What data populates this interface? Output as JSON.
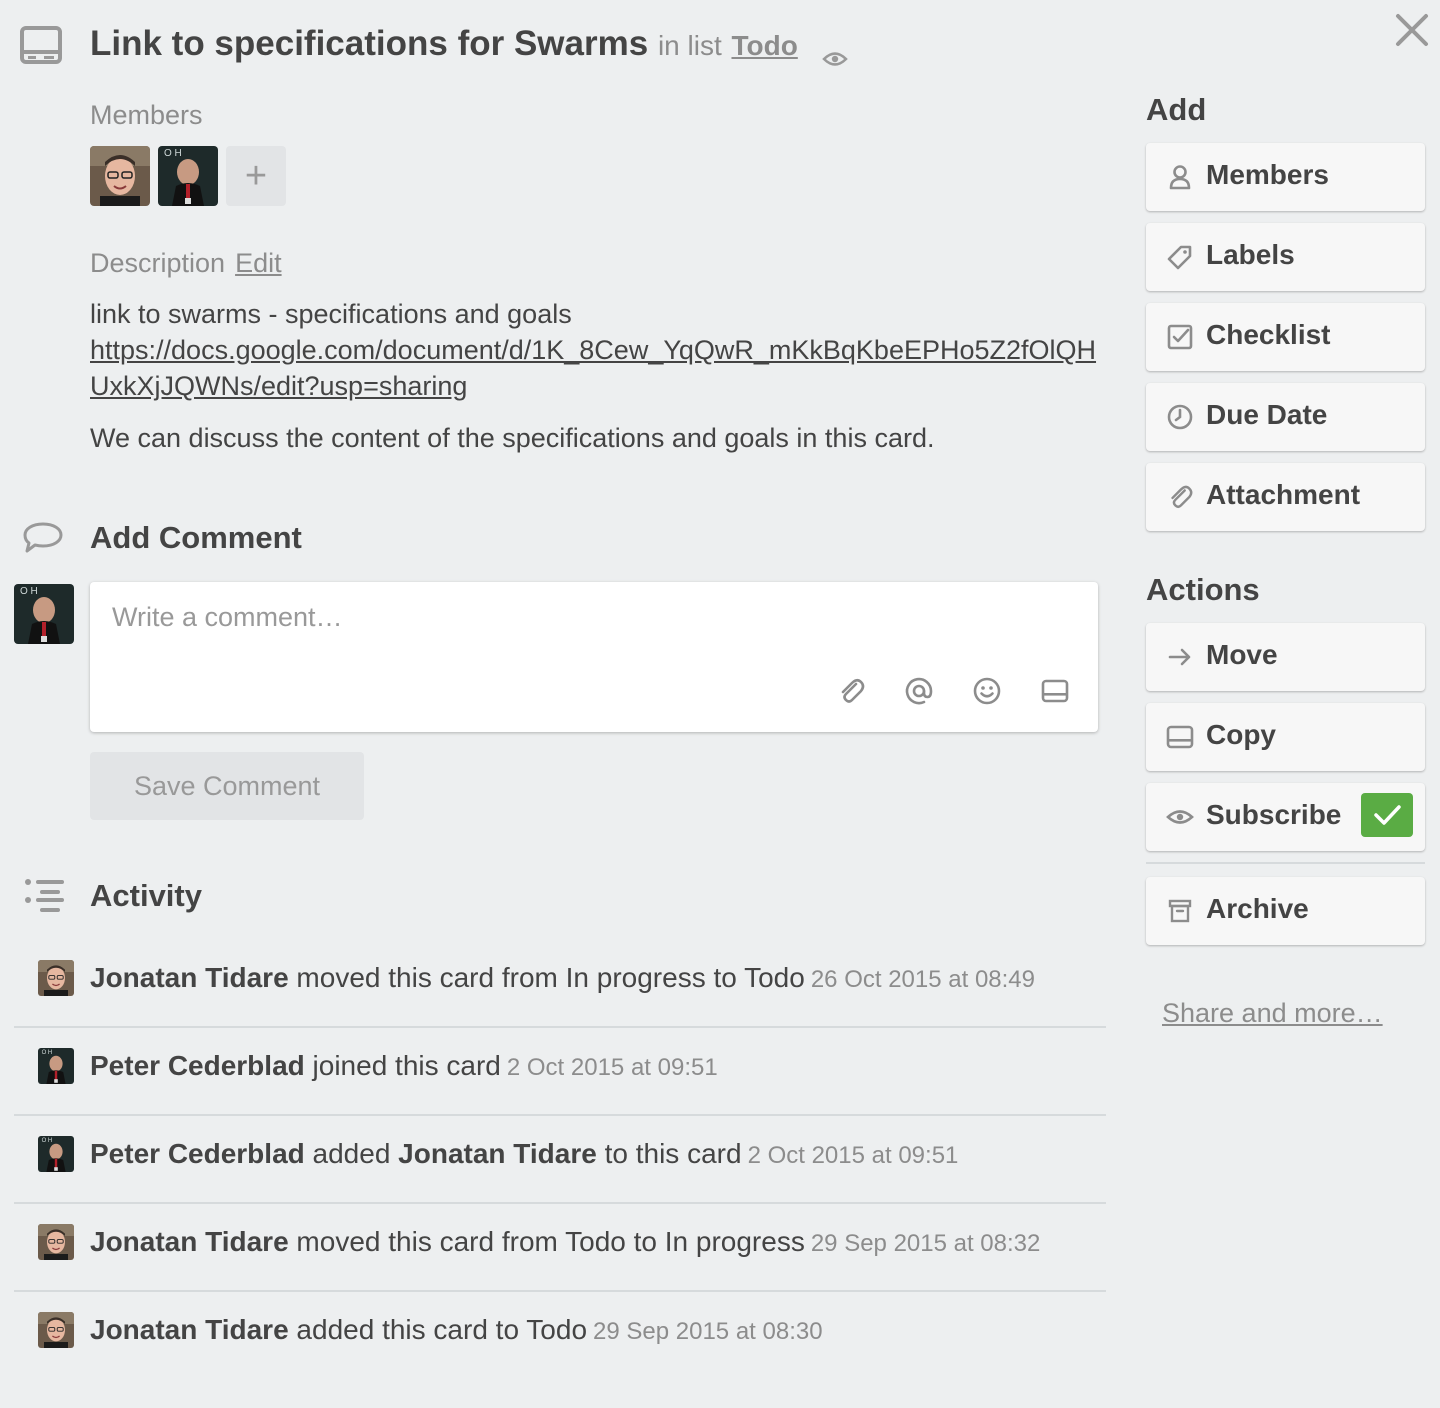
{
  "card": {
    "title": "Link to specifications for Swarms",
    "in_list_prefix": "in list",
    "list_name": "Todo"
  },
  "members": {
    "label": "Members",
    "add_symbol": "+",
    "avatars": [
      "Jonatan Tidare",
      "Peter Cederblad"
    ]
  },
  "description": {
    "label": "Description",
    "edit_label": "Edit",
    "line1": "link to swarms - specifications and goals",
    "link": "https://docs.google.com/document/d/1K_8Cew_YqQwR_mKkBqKbeEPHo5Z2fOlQHUxkXjJQWNs/edit?usp=sharing",
    "line2": "We can discuss the content of the specifications and goals in this card."
  },
  "comment": {
    "heading": "Add Comment",
    "placeholder": "Write a comment…",
    "save_label": "Save Comment"
  },
  "activity": {
    "heading": "Activity",
    "items": [
      {
        "actor": "Jonatan Tidare",
        "text": " moved this card from In progress to Todo",
        "date": "26 Oct 2015 at 08:49"
      },
      {
        "actor": "Peter Cederblad",
        "text": " joined this card",
        "date": "2 Oct 2015 at 09:51"
      },
      {
        "actor": "Peter Cederblad",
        "text": " added ",
        "target": "Jonatan Tidare",
        "text2": " to this card",
        "date": "2 Oct 2015 at 09:51"
      },
      {
        "actor": "Jonatan Tidare",
        "text": " moved this card from Todo to In progress",
        "date": "29 Sep 2015 at 08:32"
      },
      {
        "actor": "Jonatan Tidare",
        "text": " added this card to Todo",
        "date": "29 Sep 2015 at 08:30"
      }
    ]
  },
  "sidebar": {
    "add_heading": "Add",
    "add_buttons": [
      "Members",
      "Labels",
      "Checklist",
      "Due Date",
      "Attachment"
    ],
    "actions_heading": "Actions",
    "action_buttons": [
      "Move",
      "Copy",
      "Subscribe"
    ],
    "archive_label": "Archive",
    "share_label": "Share and more…",
    "subscribe_checked": true
  },
  "colors": {
    "background": "#edeff0",
    "subscribe_check": "#5aac44",
    "text": "#444444",
    "muted": "#8c8c8c"
  }
}
